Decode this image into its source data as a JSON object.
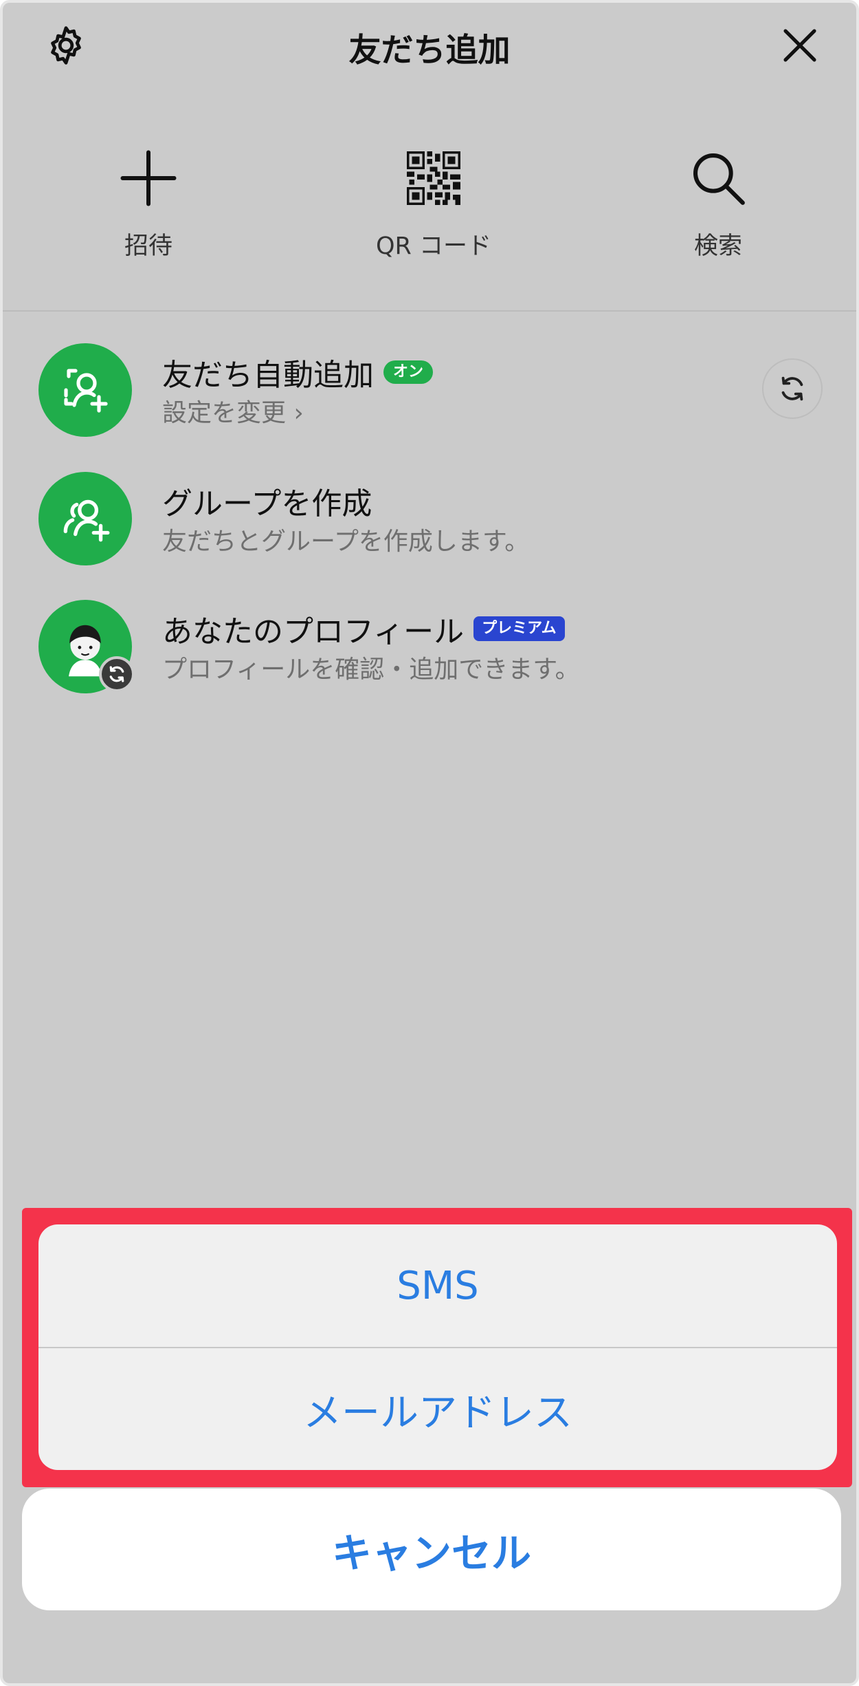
{
  "header": {
    "title": "友だち追加"
  },
  "actions": [
    {
      "label": "招待",
      "icon": "plus-icon"
    },
    {
      "label": "QR コード",
      "icon": "qr-code-icon"
    },
    {
      "label": "検索",
      "icon": "search-icon"
    }
  ],
  "rows": [
    {
      "title": "友だち自動追加",
      "badge": "オン",
      "subtitle": "設定を変更 ›",
      "icon": "person-add-icon"
    },
    {
      "title": "グループを作成",
      "subtitle": "友だちとグループを作成します。",
      "icon": "group-add-icon"
    },
    {
      "title": "あなたのプロフィール",
      "badge": "プレミアム",
      "subtitle": "プロフィールを確認・追加できます。",
      "icon": "avatar-icon"
    }
  ],
  "sheet": {
    "sms_label": "SMS",
    "email_label": "メールアドレス",
    "cancel_label": "キャンセル"
  },
  "colors": {
    "accent_green": "#20ad4b",
    "link_blue": "#2a7de1",
    "highlight_red": "#f4334b",
    "premium_blue": "#2a45d0"
  }
}
